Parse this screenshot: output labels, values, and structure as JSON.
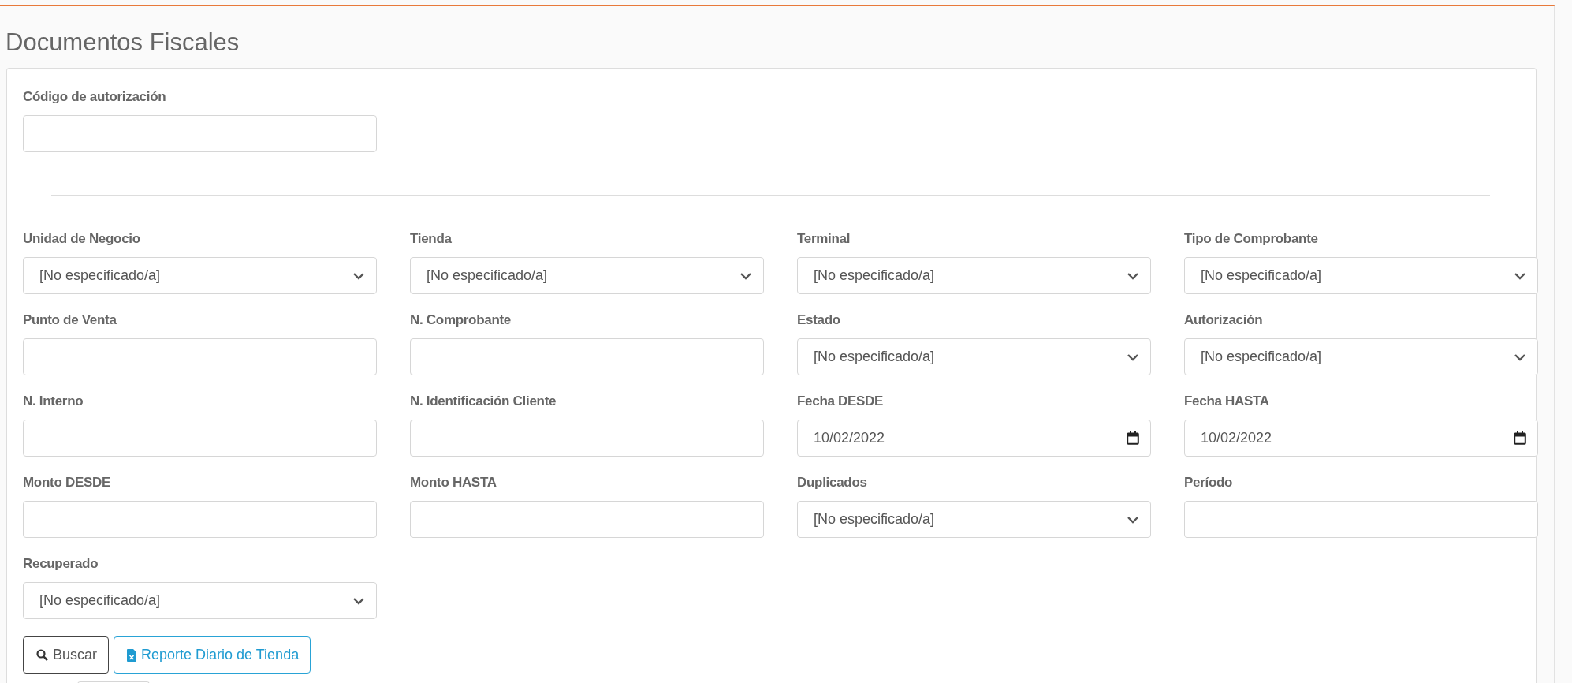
{
  "title": "Documentos Fiscales",
  "auth_field": {
    "label": "Código de autorización"
  },
  "fields": [
    {
      "label": "Unidad de Negocio",
      "kind": "select",
      "value": "[No especificado/a]"
    },
    {
      "label": "Tienda",
      "kind": "select",
      "value": "[No especificado/a]"
    },
    {
      "label": "Terminal",
      "kind": "select",
      "value": "[No especificado/a]"
    },
    {
      "label": "Tipo de Comprobante",
      "kind": "select",
      "value": "[No especificado/a]"
    },
    {
      "label": "Punto de Venta",
      "kind": "text"
    },
    {
      "label": "N. Comprobante",
      "kind": "text"
    },
    {
      "label": "Estado",
      "kind": "select",
      "value": "[No especificado/a]"
    },
    {
      "label": "Autorización",
      "kind": "select",
      "value": "[No especificado/a]"
    },
    {
      "label": "N. Interno",
      "kind": "text"
    },
    {
      "label": "N. Identificación Cliente",
      "kind": "text"
    },
    {
      "label": "Fecha DESDE",
      "kind": "date",
      "value": "10/02/2022"
    },
    {
      "label": "Fecha HASTA",
      "kind": "date",
      "value": "10/02/2022"
    },
    {
      "label": "Monto DESDE",
      "kind": "text"
    },
    {
      "label": "Monto HASTA",
      "kind": "text"
    },
    {
      "label": "Duplicados",
      "kind": "select",
      "value": "[No especificado/a]"
    },
    {
      "label": "Período",
      "kind": "text"
    },
    {
      "label": "Recuperado",
      "kind": "select",
      "value": "[No especificado/a]"
    }
  ],
  "buttons": [
    {
      "label": "Buscar",
      "kind": "search"
    },
    {
      "label": "Reporte Diario de Tienda",
      "kind": "report"
    }
  ]
}
